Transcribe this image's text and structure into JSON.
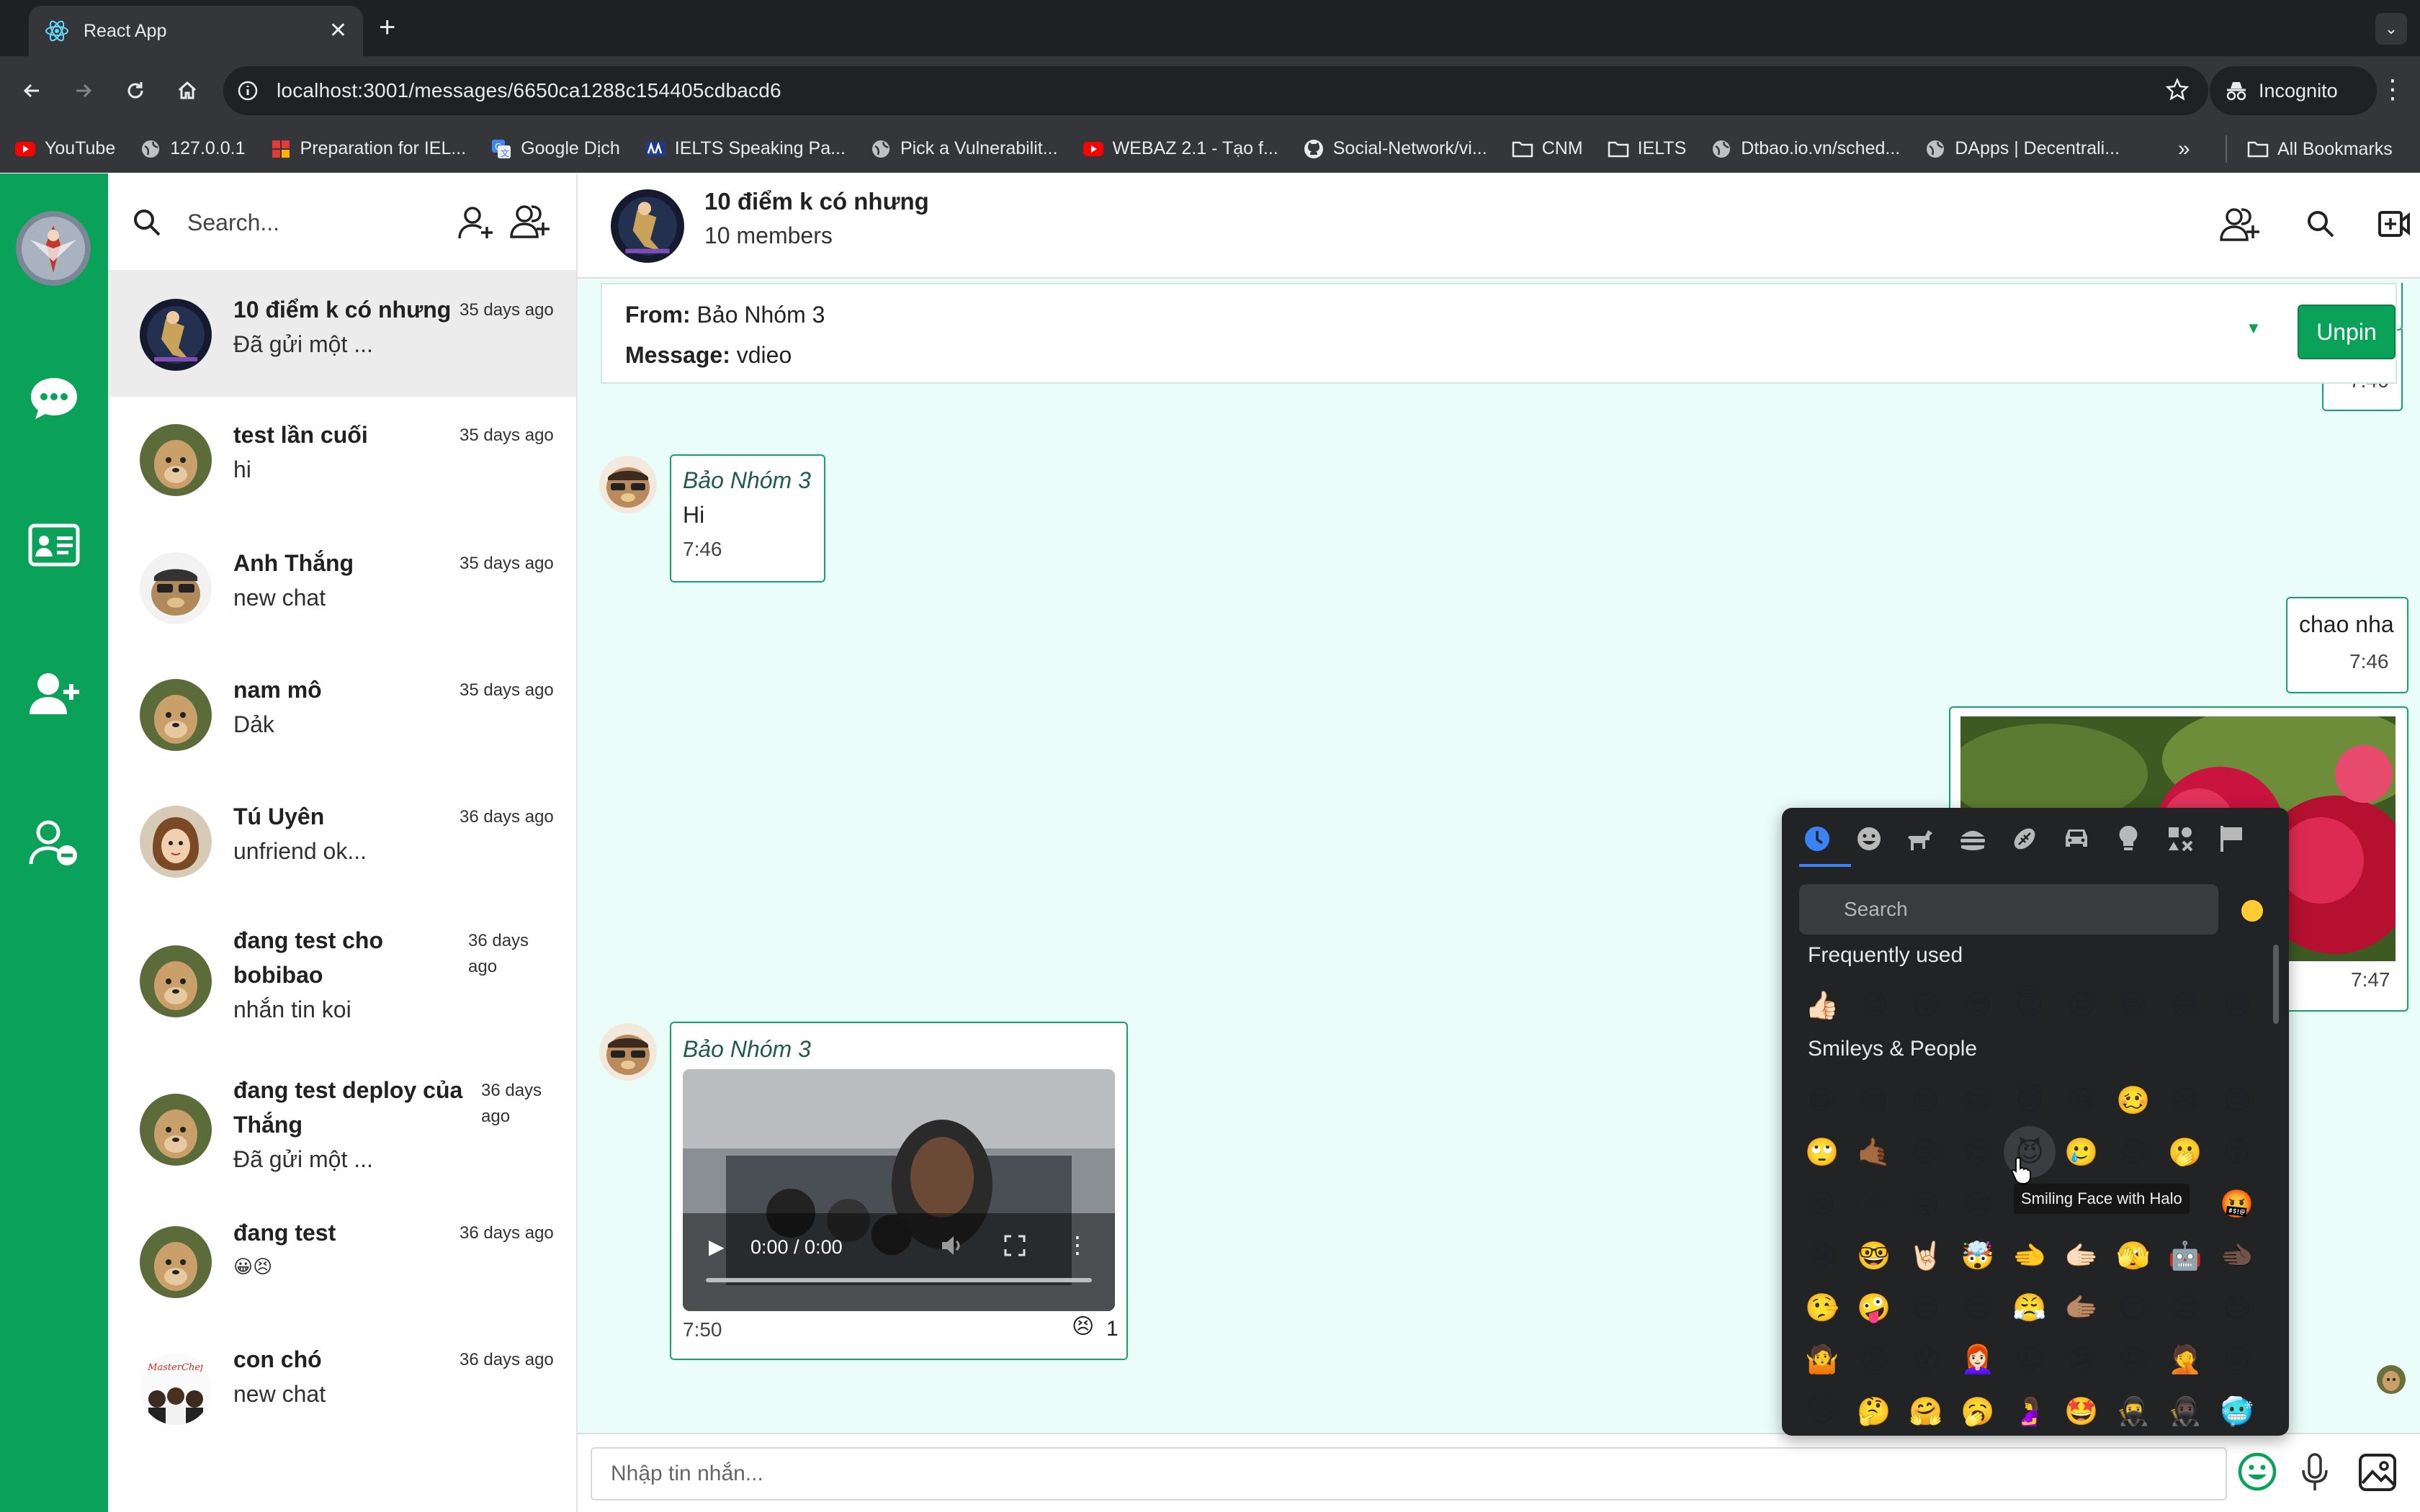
{
  "browser": {
    "tab_title": "React App",
    "url": "localhost:3001/messages/6650ca1288c154405cdbacd6",
    "incognito_label": "Incognito",
    "bookmarks": [
      {
        "label": "YouTube",
        "icon": "youtube-icon"
      },
      {
        "label": "127.0.0.1",
        "icon": "globe-icon"
      },
      {
        "label": "Preparation for IEL...",
        "icon": "grid-icon"
      },
      {
        "label": "Google Dịch",
        "icon": "translate-icon"
      },
      {
        "label": "IELTS Speaking Pa...",
        "icon": "ielts-icon"
      },
      {
        "label": "Pick a Vulnerabilit...",
        "icon": "globe-icon"
      },
      {
        "label": "WEBAZ 2.1 - Tạo f...",
        "icon": "youtube-icon"
      },
      {
        "label": "Social-Network/vi...",
        "icon": "github-icon"
      },
      {
        "label": "CNM",
        "icon": "folder-icon"
      },
      {
        "label": "IELTS",
        "icon": "folder-icon"
      },
      {
        "label": "Dtbao.io.vn/sched...",
        "icon": "globe-icon"
      },
      {
        "label": "DApps | Decentrali...",
        "icon": "globe-icon"
      }
    ],
    "bookmarks_more": "»",
    "all_bookmarks": "All Bookmarks"
  },
  "conv_list": {
    "search_placeholder": "Search...",
    "items": [
      {
        "name": "10 điểm k có nhưng",
        "message": "Đã gửi một ...",
        "time": "35 days ago",
        "active": true
      },
      {
        "name": "test lần cuối",
        "message": "hi",
        "time": "35 days ago"
      },
      {
        "name": "Anh Thắng",
        "message": "new chat",
        "time": "35 days ago"
      },
      {
        "name": "nam mô",
        "message": "Dảk",
        "time": "35 days ago"
      },
      {
        "name": "Tú Uyên",
        "message": "unfriend ok...",
        "time": "36 days ago"
      },
      {
        "name_l1": "đang test cho",
        "name_l2": "bobibao",
        "message": "nhắn tin koi",
        "time_l1": "36 days",
        "time_l2": "ago"
      },
      {
        "name_l1": "đang test deploy của",
        "name_l2": "Thắng",
        "message": "Đã gửi một ...",
        "time_l1": "36 days",
        "time_l2": "ago"
      },
      {
        "name": "đang test",
        "message": "😀😣",
        "time": "36 days ago"
      },
      {
        "name": "con chó",
        "message": "new chat",
        "time": "36 days ago",
        "avatar_text": "MasterChef"
      }
    ]
  },
  "chat": {
    "group_name": "10 điểm k có nhưng",
    "members": "10 members",
    "pinned": {
      "from_label": "From:",
      "from_value": "Bảo Nhóm 3",
      "message_label": "Message:",
      "message_value": "vdieo",
      "unpin_label": "Unpin"
    },
    "messages": [
      {
        "id": "m0",
        "time": "7:46",
        "mine": true
      },
      {
        "id": "m1",
        "sender": "Bảo Nhóm 3",
        "text": "Hi",
        "time": "7:46"
      },
      {
        "id": "m2",
        "text": "chao nha",
        "time": "7:46",
        "mine": true
      },
      {
        "id": "m3",
        "time": "7:47",
        "mine": true,
        "type": "image"
      },
      {
        "id": "m4",
        "sender": "Bảo Nhóm 3",
        "type": "video",
        "video_time": "0:00 / 0:00",
        "time": "7:50",
        "reaction_emoji": "😣",
        "reaction_count": "1"
      }
    ],
    "composer_placeholder": "Nhập tin nhắn..."
  },
  "emoji_picker": {
    "search_placeholder": "Search",
    "tabs": [
      "clock-icon",
      "smiley-icon",
      "animal-icon",
      "food-icon",
      "activity-icon",
      "travel-icon",
      "bulb-icon",
      "symbols-icon",
      "flag-icon"
    ],
    "frequently_used_label": "Frequently used",
    "frequently_used": [
      "👍🏻",
      "😁",
      "😙",
      "😎",
      "😇",
      "😝",
      "😆",
      "😃",
      "😲"
    ],
    "smileys_label": "Smileys & People",
    "smileys": [
      [
        "😁",
        "😄",
        "😅",
        "😂",
        "😇",
        "😆",
        "🥴",
        "😃",
        "🙃"
      ],
      [
        "🙄",
        "🤙🏾",
        "😊",
        "😋",
        "😈",
        "🥲",
        "😎",
        "🫢",
        "😙"
      ],
      [
        "😘",
        "⚛",
        "😛",
        "☺",
        "",
        "",
        "",
        "",
        "🤬"
      ],
      [
        "😞",
        "🤓",
        "🤘🏻",
        "🤯",
        "🫲",
        "🫱🏻",
        "🫣",
        "🤖",
        "🫲🏿"
      ],
      [
        "🤥",
        "🤪",
        "😑",
        "😒",
        "😤",
        "🫱🏽",
        "😶",
        "😐",
        "😓"
      ],
      [
        "🤷",
        "😭",
        "😯",
        "👩🏻‍🦰",
        "😍",
        "😕",
        "😣",
        "🤦",
        "😵"
      ],
      [
        "😼",
        "🤔",
        "🤗",
        "🥱",
        "🤰",
        "🤩",
        "🥷",
        "🥷🏿",
        "🥶"
      ]
    ],
    "tooltip": "Smiling Face with Halo"
  }
}
